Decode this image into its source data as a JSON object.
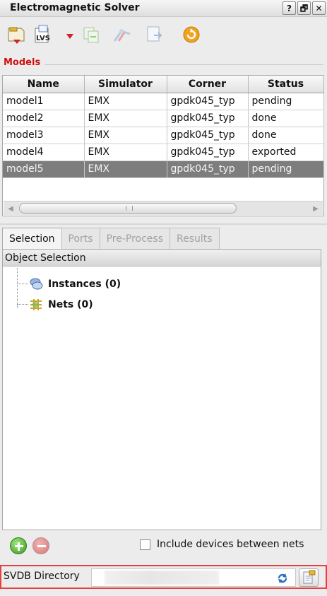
{
  "window": {
    "title": "Electromagnetic Solver",
    "buttons": [
      "?",
      "🗗",
      "✕"
    ]
  },
  "toolbar": {
    "icons": [
      "new-model-icon",
      "lvs-icon",
      "copy-icon",
      "flow-icon",
      "export-icon",
      "refresh-icon"
    ],
    "lvs_text": "LVS"
  },
  "models": {
    "section_label": "Models",
    "columns": [
      "Name",
      "Simulator",
      "Corner",
      "Status"
    ],
    "rows": [
      [
        "model1",
        "EMX",
        "gpdk045_typ",
        "pending"
      ],
      [
        "model2",
        "EMX",
        "gpdk045_typ",
        "done"
      ],
      [
        "model3",
        "EMX",
        "gpdk045_typ",
        "done"
      ],
      [
        "model4",
        "EMX",
        "gpdk045_typ",
        "exported"
      ],
      [
        "model5",
        "EMX",
        "gpdk045_typ",
        "pending"
      ]
    ],
    "selected_row": 4
  },
  "tabs": [
    {
      "label": "Selection",
      "active": true
    },
    {
      "label": "Ports",
      "active": false
    },
    {
      "label": "Pre-Process",
      "active": false
    },
    {
      "label": "Results",
      "active": false
    }
  ],
  "tree": {
    "header": "Object Selection",
    "items": [
      {
        "label": "Instances (0)",
        "icon": "instances-icon"
      },
      {
        "label": "Nets (0)",
        "icon": "nets-icon"
      }
    ]
  },
  "options": {
    "include_devices_label": "Include devices between nets",
    "include_devices_checked": false
  },
  "svdb": {
    "label": "SVDB Directory",
    "value": ""
  }
}
